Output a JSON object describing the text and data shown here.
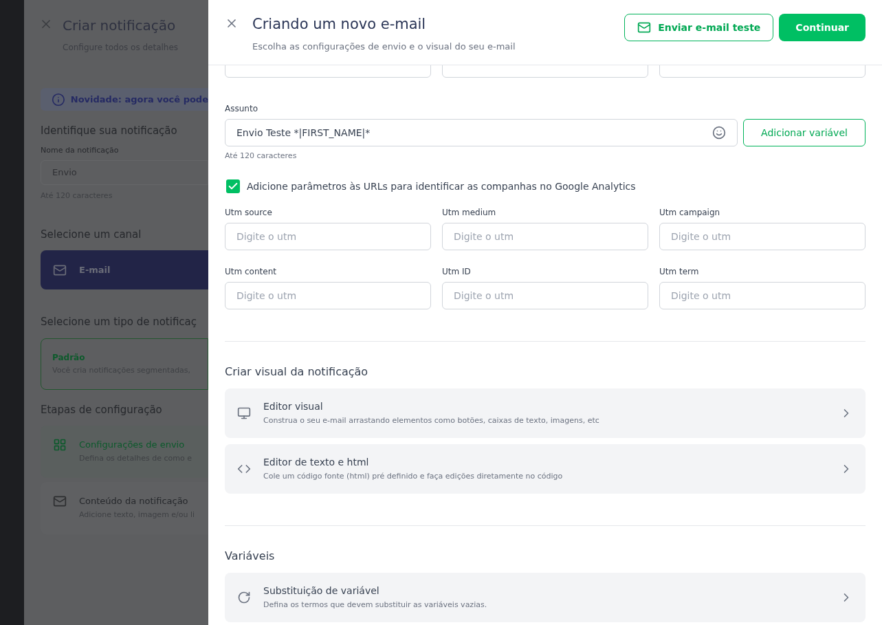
{
  "background_panel": {
    "title": "Criar notificação",
    "subtitle": "Configure todos os detalhes",
    "notice": "Novidade: agora você pode",
    "identify_heading": "Identifique sua notificação",
    "name_label": "Nome da notificação",
    "name_value": "Envio",
    "name_hint": "Até 120 caracteres",
    "channel_heading": "Selecione um canal",
    "channel": "E-mail",
    "type_heading": "Selecione um tipo de notificaç",
    "type_option": {
      "title": "Padrão",
      "description": "Você cria notificações segmentadas,"
    },
    "steps_heading": "Etapas de configuração",
    "steps": [
      {
        "kind": "grid",
        "title": "Configurações de envio",
        "description": "Defina os detalhes de como e",
        "selected": true
      },
      {
        "kind": "mail",
        "title": "Conteúdo da notificação",
        "description": "Adicione texto, imagem e/ou li",
        "selected": false
      }
    ]
  },
  "drawer": {
    "title": "Criando um novo e-mail",
    "subtitle": "Escolha as configurações de envio e o visual do seu e-mail",
    "test_button": "Enviar e-mail teste",
    "continue_button": "Continuar",
    "subject": {
      "label": "Assunto",
      "value": "Envio Teste *|FIRST_NAME|*",
      "hint": "Até 120 caracteres",
      "add_variable_button": "Adicionar variável"
    },
    "utm_checkbox": {
      "label": "Adicione parâmetros às URLs para identificar as companhas no Google Analytics",
      "checked": true
    },
    "utm_fields": [
      {
        "label": "Utm source",
        "placeholder": "Digite o utm"
      },
      {
        "label": "Utm medium",
        "placeholder": "Digite o utm"
      },
      {
        "label": "Utm campaign",
        "placeholder": "Digite o utm"
      },
      {
        "label": "Utm content",
        "placeholder": "Digite o utm"
      },
      {
        "label": "Utm ID",
        "placeholder": "Digite o utm"
      },
      {
        "label": "Utm term",
        "placeholder": "Digite o utm"
      }
    ],
    "sections": [
      {
        "heading": "Criar visual da notificação",
        "options": [
          {
            "kind": "monitor",
            "title": "Editor visual",
            "description": "Construa o seu e-mail arrastando elementos como botões, caixas de texto, imagens, etc"
          },
          {
            "kind": "code",
            "title": "Editor de texto e html",
            "description": "Cole um código fonte (html) pré definido e faça edições diretamente no código"
          }
        ]
      },
      {
        "heading": "Variáveis",
        "options": [
          {
            "kind": "refresh",
            "title": "Substituição de variável",
            "description": "Defina os termos que devem substituir as variáveis vazias."
          }
        ]
      }
    ]
  }
}
